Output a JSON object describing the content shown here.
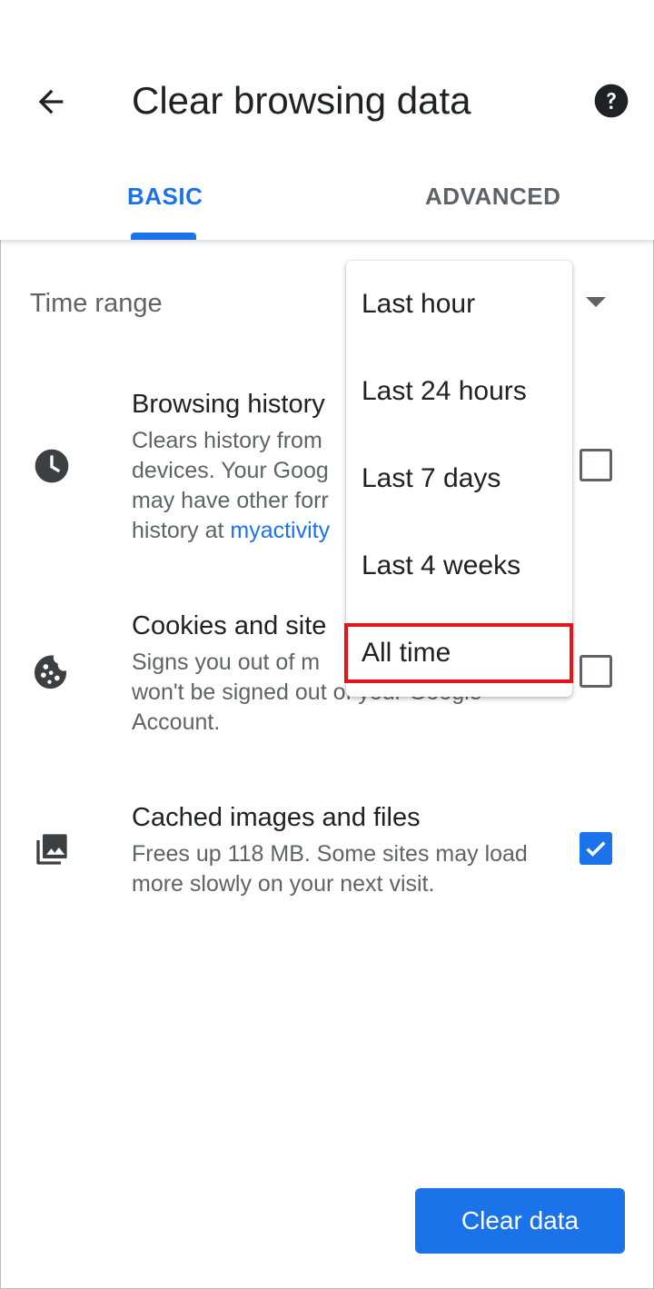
{
  "header": {
    "title": "Clear browsing data",
    "back_icon": "arrow-back-icon",
    "help_icon": "help-icon"
  },
  "tabs": [
    {
      "label": "BASIC",
      "selected": true
    },
    {
      "label": "ADVANCED",
      "selected": false
    }
  ],
  "time_range": {
    "label": "Time range",
    "dropdown_icon": "dropdown-arrow-icon",
    "options": [
      "Last hour",
      "Last 24 hours",
      "Last 7 days",
      "Last 4 weeks",
      "All time"
    ],
    "highlighted_option": "All time"
  },
  "items": [
    {
      "icon": "clock-icon",
      "title": "Browsing history",
      "desc_visible": "Clears history from",
      "desc_line2": "devices. Your Goog",
      "desc_line3": "may have other forr",
      "desc_line4_prefix": "history at ",
      "desc_link": "myactivity",
      "checked": false
    },
    {
      "icon": "cookie-icon",
      "title": "Cookies and site",
      "desc_line1": "Signs you out of m",
      "desc_line2": "won't be signed out of your Google",
      "desc_line3": "Account.",
      "checked": false
    },
    {
      "icon": "images-icon",
      "title": "Cached images and files",
      "desc": "Frees up 118 MB. Some sites may load more slowly on your next visit.",
      "checked": true
    }
  ],
  "actions": {
    "clear_label": "Clear data"
  },
  "colors": {
    "accent": "#1a73e8",
    "highlight": "#e8121b",
    "secondary_text": "#5f6368"
  }
}
